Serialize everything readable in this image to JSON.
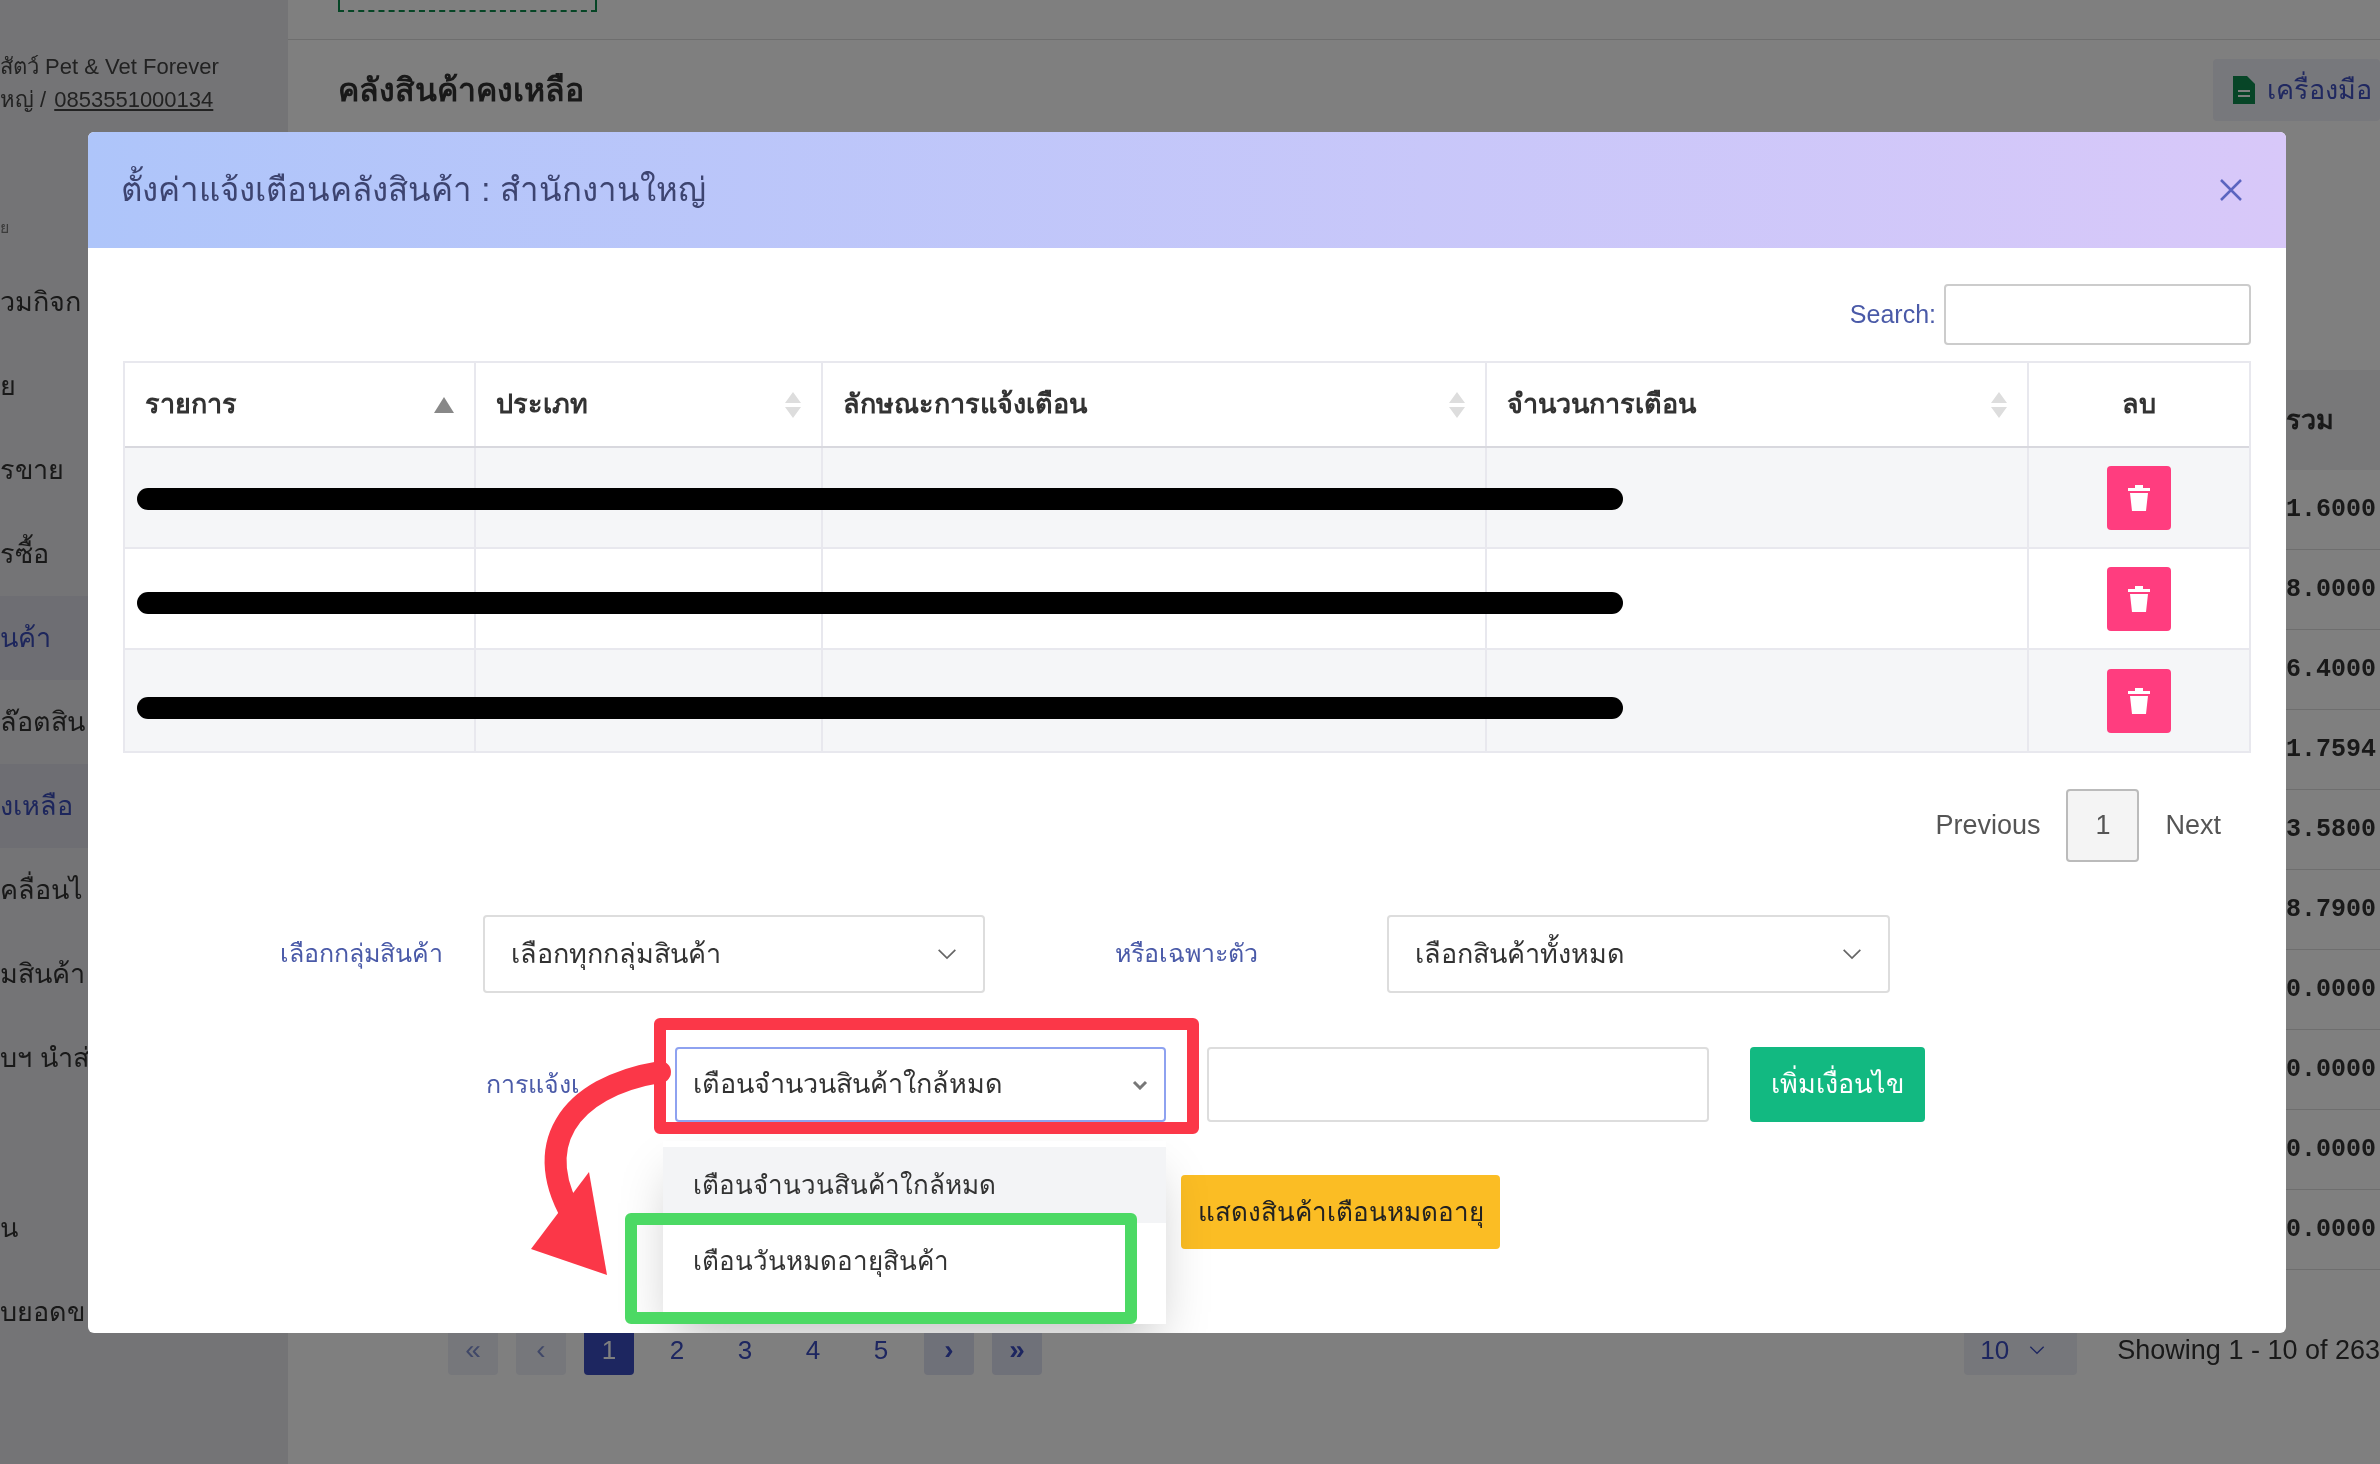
{
  "background": {
    "sidebar": {
      "shop": "สัตว์ Pet & Vet Forever",
      "branch": "หญ่ /",
      "phone": "0853551000134",
      "section": "ย",
      "items": [
        {
          "label": "วมกิจก",
          "selected": false
        },
        {
          "label": "ย",
          "selected": false
        },
        {
          "label": "รขาย",
          "selected": false
        },
        {
          "label": "รซื้อ",
          "selected": false
        },
        {
          "label": "นค้า",
          "selected": true
        },
        {
          "label": "ล๊อตสิน",
          "selected": false
        },
        {
          "label": "งเหลือ",
          "selected": true
        },
        {
          "label": "คลื่อนไ",
          "selected": false
        },
        {
          "label": "มสินค้า",
          "selected": false
        },
        {
          "label": "บฯ นำส่",
          "selected": false
        },
        {
          "label": "น",
          "selected": false
        },
        {
          "label": "บยอดข",
          "selected": false
        }
      ]
    },
    "page_title": "คลังสินค้าคงเหลือ",
    "tool_button": "เครื่องมือ",
    "table": {
      "column_label": "รวม",
      "values": [
        "1.6000",
        "8.0000",
        "6.4000",
        "1.7594",
        "3.5800",
        "8.7900",
        "0.0000",
        "0.0000",
        "0.0000",
        "0.0000"
      ]
    },
    "pagination": {
      "first": "«",
      "prev": "‹",
      "next": "›",
      "last": "»",
      "pages": [
        {
          "label": "1",
          "selected": true
        },
        {
          "label": "2",
          "selected": false
        },
        {
          "label": "3",
          "selected": false
        },
        {
          "label": "4",
          "selected": false
        },
        {
          "label": "5",
          "selected": false
        }
      ]
    },
    "page_size": "10",
    "showing": "Showing 1 - 10 of 263"
  },
  "modal": {
    "title": "ตั้งค่าแจ้งเตือนคลังสินค้า : สำนักงานใหญ่",
    "search_label": "Search:",
    "columns": [
      {
        "label": "รายการ",
        "sortable": true,
        "sorted": true
      },
      {
        "label": "ประเภท",
        "sortable": true,
        "sorted": false
      },
      {
        "label": "ลักษณะการแจ้งเตือน",
        "sortable": true,
        "sorted": false
      },
      {
        "label": "จำนวนการเตือน",
        "sortable": true,
        "sorted": false
      },
      {
        "label": "ลบ",
        "sortable": false
      }
    ],
    "rows": [
      {
        "redacted": true
      },
      {
        "redacted": true
      },
      {
        "redacted": true
      }
    ],
    "pagination": {
      "previous": "Previous",
      "page": "1",
      "next": "Next"
    },
    "group_label": "เลือกกลุ่มสินค้า",
    "group_select": "เลือกทุกกลุ่มสินค้า",
    "item_label": "หรือเฉพาะตัว",
    "item_select": "เลือกสินค้าทั้งหมด",
    "alert_label": "การแจ้งเ",
    "alert_select": "เตือนจำนวนสินค้าใกล้หมด",
    "add_button": "เพิ่มเงื่อนไข",
    "show_button": "แสดงสินค้าเตือนหมดอายุ",
    "options": [
      {
        "label": "เตือนจำนวนสินค้าใกล้หมด",
        "selected": true
      },
      {
        "label": "เตือนวันหมดอายุสินค้า",
        "selected": false
      }
    ]
  }
}
